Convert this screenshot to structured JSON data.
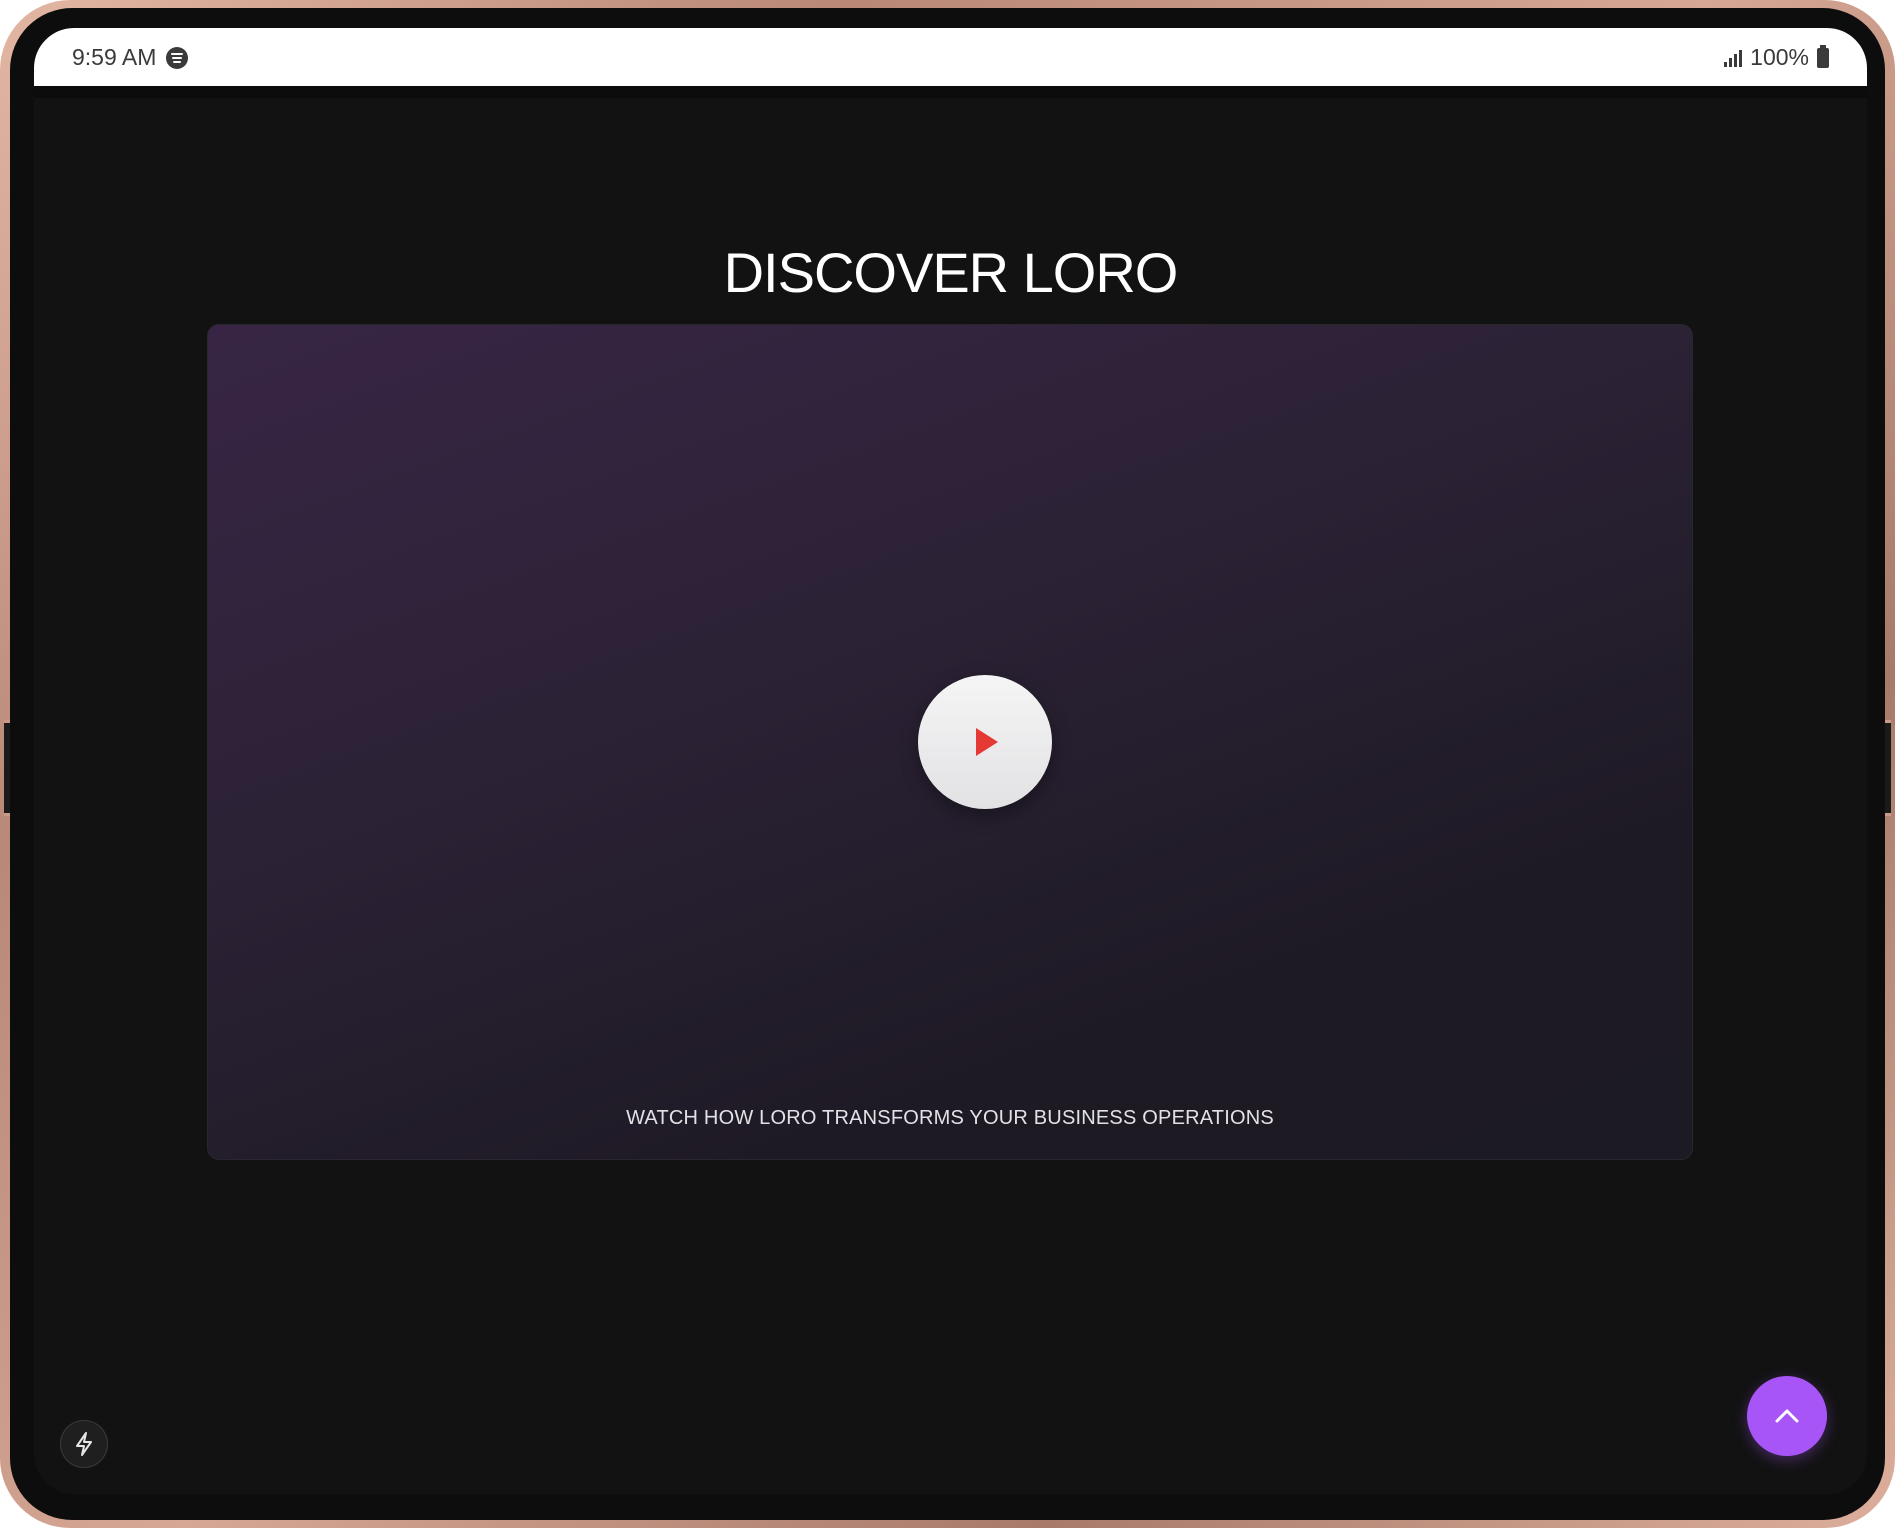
{
  "status_bar": {
    "time": "9:59 AM",
    "battery": "100%"
  },
  "main": {
    "title": "DISCOVER LORO",
    "video": {
      "caption": "WATCH HOW LORO TRANSFORMS YOUR BUSINESS OPERATIONS"
    }
  },
  "icons": {
    "status_media": "spotify-icon",
    "signal": "signal-icon",
    "battery": "battery-icon",
    "play": "play-icon",
    "bolt": "bolt-icon",
    "scroll_top": "chevron-up-icon"
  },
  "colors": {
    "background": "#121212",
    "accent": "#a855f7",
    "play_icon": "#e53935",
    "card_gradient_start": "#382545",
    "card_gradient_end": "#1c1a22"
  }
}
